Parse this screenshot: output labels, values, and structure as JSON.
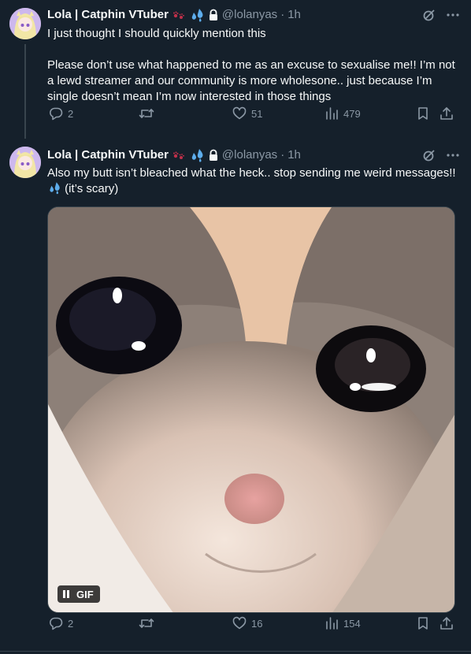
{
  "colors": {
    "background": "#15202b",
    "text": "#f7f9f9",
    "muted": "#8b98a5",
    "divider": "#38444d"
  },
  "tweets": [
    {
      "display_name": "Lola | Catphin VTuber",
      "handle": "@lolanyas",
      "separator": "·",
      "time": "1h",
      "text": "I just thought I should quickly mention this\n\nPlease don’t use what happened to me as an excuse to sexualise me!! I’m not a lewd streamer and our community is more wholesone.. just because I’m single doesn’t mean I’m now interested in those things",
      "replies": "2",
      "likes": "51",
      "views": "479"
    },
    {
      "display_name": "Lola | Catphin VTuber",
      "handle": "@lolanyas",
      "separator": "·",
      "time": "1h",
      "text_before_emoji": "Also my butt isn’t bleached what the heck.. stop sending me weird messages!! ",
      "text_after_emoji": " (it’s scary)",
      "media_badge": "GIF",
      "replies": "2",
      "likes": "16",
      "views": "154"
    }
  ]
}
